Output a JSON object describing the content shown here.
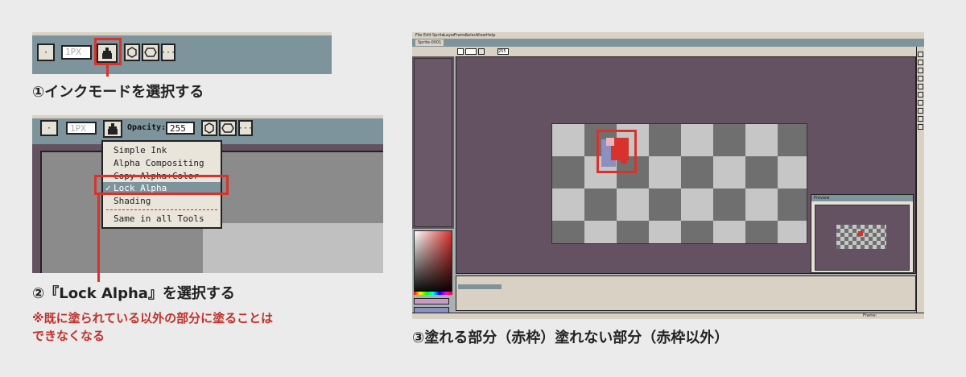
{
  "panel1": {
    "toolbar": {
      "dot_label": "·",
      "size_value": "1PX",
      "more_label": "···"
    },
    "caption": "①インクモードを選択する"
  },
  "panel2": {
    "toolbar": {
      "dot_label": "·",
      "size_value": "1PX",
      "opacity_label": "Opacity:",
      "opacity_value": "255",
      "more_label": "···"
    },
    "ink_menu": {
      "items": [
        "Simple Ink",
        "Alpha Compositing",
        "Copy Alpha+Color",
        "Lock Alpha",
        "Shading",
        "Same in all Tools"
      ],
      "selected": "Lock Alpha",
      "check_mark": "✓"
    },
    "caption": "②『Lock Alpha』を選択する",
    "note_line1": "※既に塗られている以外の部分に塗ることは",
    "note_line2": "できなくなる"
  },
  "panel3": {
    "menubar": [
      "File",
      "Edit",
      "Sprite",
      "Layer",
      "Frame",
      "Select",
      "View",
      "Help"
    ],
    "tab_label": "Sprite-0001",
    "preview_title": "Preview",
    "opacity_value": "255",
    "bottom_frame_label": "Frame:",
    "caption": "③塗れる部分（赤枠）塗れない部分（赤枠以外）"
  },
  "colors": {
    "accent_red": "#d8322c",
    "note_red": "#c0302a",
    "toolbar_blue": "#7e949d",
    "canvas_purple": "#645262",
    "button_cream": "#e6e1d6"
  }
}
